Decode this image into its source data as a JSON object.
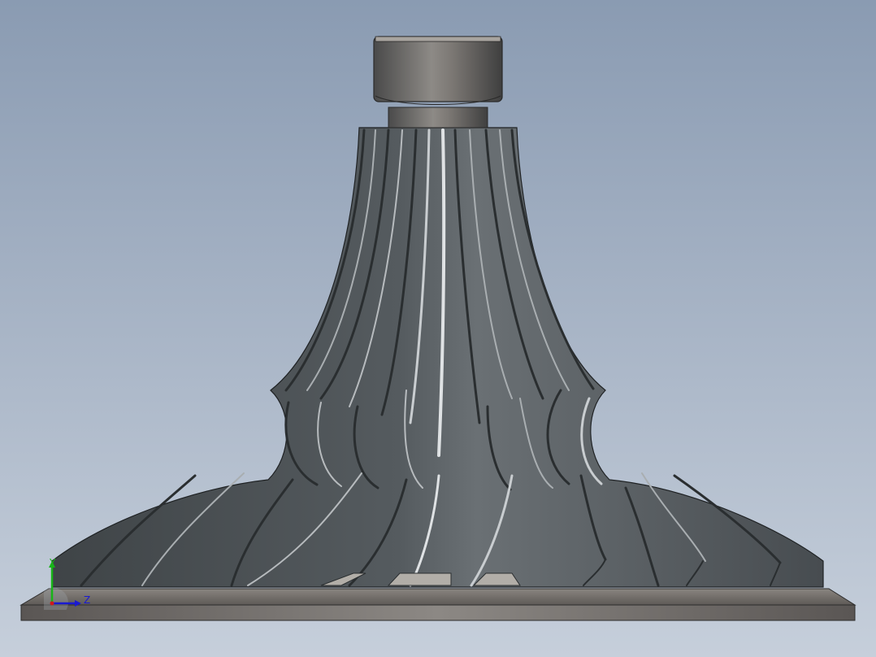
{
  "viewport": {
    "background_top": "#8a9bb2",
    "background_bottom": "#c6cfdb"
  },
  "model": {
    "part": "turbine-impeller",
    "material_color": "#5b6166",
    "highlight_color": "#c9cdd0",
    "base_color": "#6e6a66"
  },
  "triad": {
    "y_label": "Y",
    "z_label": "Z",
    "x_color": "#d11a1a",
    "y_color": "#18b418",
    "z_color": "#1a1ad1"
  }
}
